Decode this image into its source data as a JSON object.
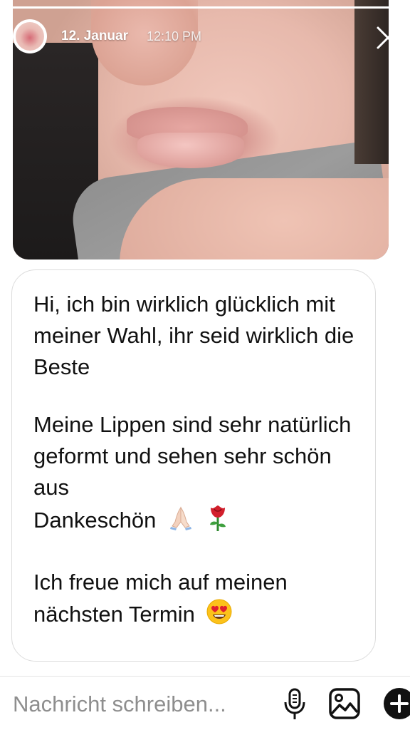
{
  "story": {
    "progress": 1.0,
    "date": "12. Januar",
    "time": "12:10 PM"
  },
  "message": {
    "paragraphs": [
      "Hi, ich bin wirklich glücklich mit meiner Wahl, ihr seid wirklich die Beste",
      "Meine Lippen sind sehr natürlich geformt und sehen sehr schön aus",
      "Dankeschön",
      "Ich freue mich auf meinen nächsten Termin"
    ],
    "emojis": [
      "folded-hands-emoji",
      "rose-emoji",
      "heart-eyes-emoji"
    ]
  },
  "composer": {
    "placeholder": "Nachricht schreiben..."
  },
  "icons": {
    "close": "close-icon",
    "microphone": "microphone-icon",
    "gallery": "gallery-icon",
    "add": "plus-circle-icon"
  },
  "colors": {
    "text": "#111111",
    "placeholder": "#8e8e8e",
    "bubble_border": "#dcdcdc"
  }
}
